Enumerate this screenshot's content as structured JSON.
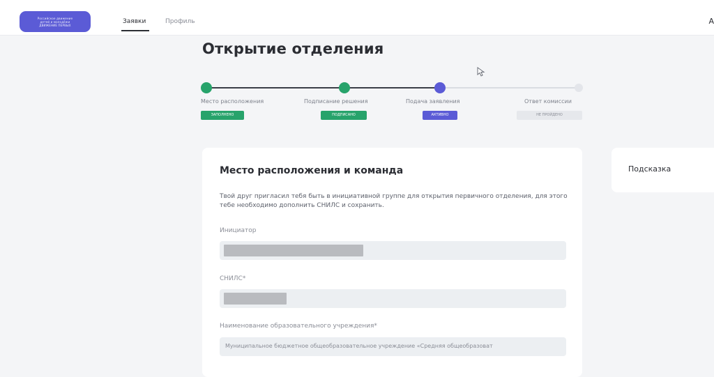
{
  "header": {
    "logo_lines": [
      "Российское движение",
      "детей и молодёжи",
      "ДВИЖЕНИЕ ПЕРВЫХ"
    ],
    "tabs": [
      {
        "label": "Заявки",
        "active": true
      },
      {
        "label": "Профиль",
        "active": false
      }
    ],
    "right_text": "А"
  },
  "page": {
    "title": "Открытие отделения"
  },
  "stepper": {
    "steps": [
      {
        "label": "Место расположения",
        "badge": "ЗАПОЛНЕНО",
        "state": "done",
        "color": "#27a36b"
      },
      {
        "label": "Подписание решения",
        "badge": "ПОДПИСАНО",
        "state": "done",
        "color": "#27a36b"
      },
      {
        "label": "Подача заявления",
        "badge": "АКТИВНО",
        "state": "active",
        "color": "#5b5bd6"
      },
      {
        "label": "Ответ комиссии",
        "badge": "НЕ ПРОЙДЕНО",
        "state": "pending",
        "color": "#e3e5ea"
      }
    ]
  },
  "form": {
    "title": "Место расположения и команда",
    "description": "Твой друг пригласил тебя быть в инициативной группе для открытия первичного отделения, для этого тебе необходимо дополнить СНИЛС и сохранить.",
    "fields": [
      {
        "label": "Инициатор",
        "value": ""
      },
      {
        "label": "СНИЛС*",
        "value": ""
      },
      {
        "label": "Наименование образовательного учреждения*",
        "value": "Муниципальное бюджетное общеобразовательное учреждение «Средняя общеобразоват"
      }
    ]
  },
  "hint": {
    "title": "Подсказка"
  }
}
